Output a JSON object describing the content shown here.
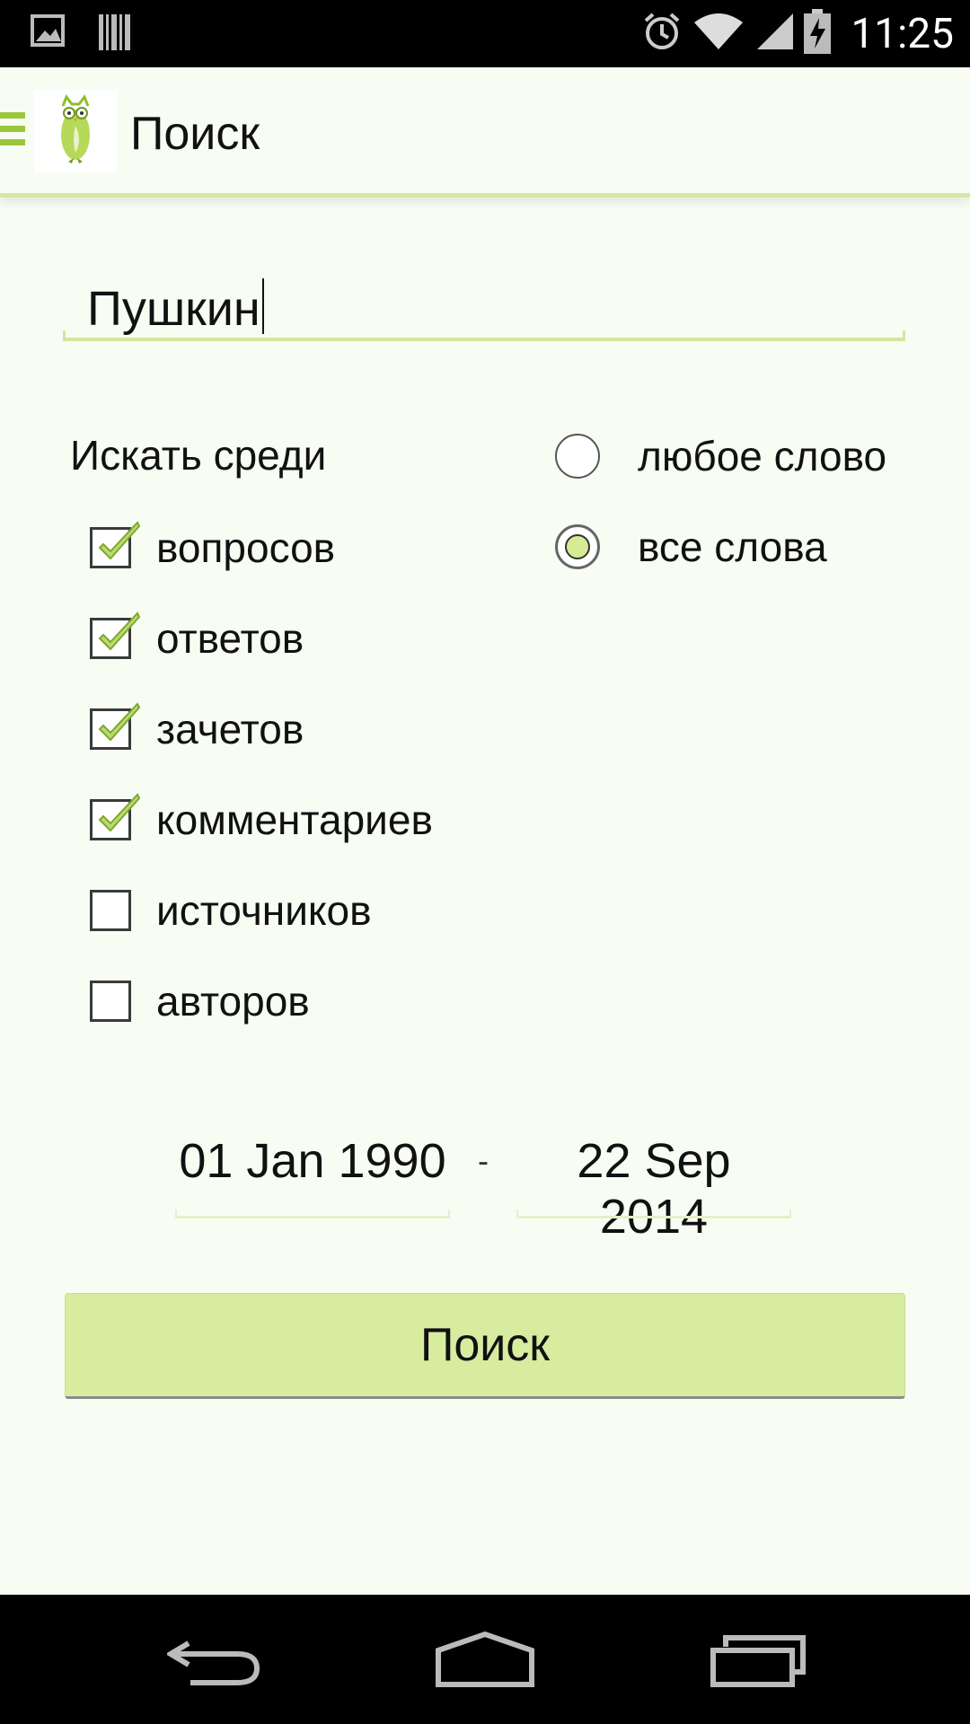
{
  "status_bar": {
    "time": "11:25",
    "icons": [
      "image-notification-icon",
      "barcode-notification-icon",
      "alarm-icon",
      "wifi-icon",
      "cellular-signal-icon",
      "battery-charging-icon"
    ]
  },
  "action_bar": {
    "title": "Поиск",
    "icons": [
      "drawer-toggle-icon",
      "owl-logo-icon"
    ]
  },
  "search": {
    "value": "Пушкин"
  },
  "filters": {
    "label": "Искать среди",
    "checkboxes": [
      {
        "label": "вопросов",
        "checked": true
      },
      {
        "label": "ответов",
        "checked": true
      },
      {
        "label": "зачетов",
        "checked": true
      },
      {
        "label": "комментариев",
        "checked": true
      },
      {
        "label": "источников",
        "checked": false
      },
      {
        "label": "авторов",
        "checked": false
      }
    ],
    "match_mode": [
      {
        "label": "любое слово",
        "selected": false
      },
      {
        "label": "все слова",
        "selected": true
      }
    ]
  },
  "date_range": {
    "from": "01 Jan 1990",
    "separator": "-",
    "to": "22 Sep 2014"
  },
  "search_button": {
    "label": "Поиск"
  },
  "colors": {
    "accent": "#9cc63b",
    "button": "#d8eca0",
    "background": "#f8fdf3"
  },
  "nav_bar": {
    "icons": [
      "back-icon",
      "home-icon",
      "recent-apps-icon"
    ]
  }
}
